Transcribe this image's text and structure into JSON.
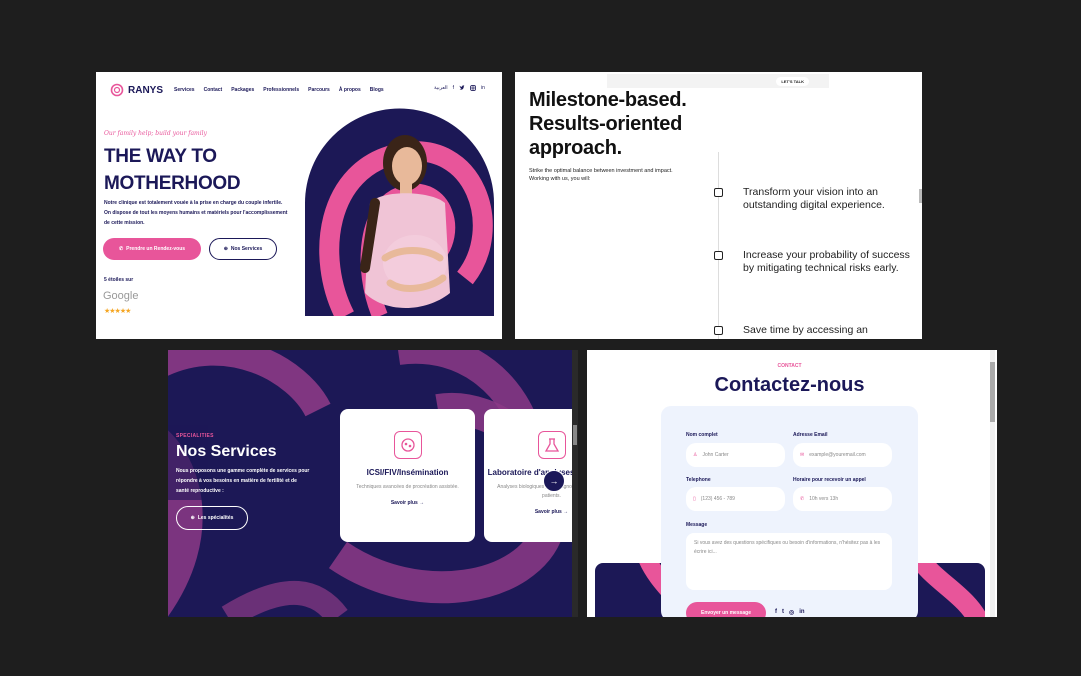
{
  "colors": {
    "navy": "#1b1858",
    "pink": "#e8559a",
    "canvas": "#1e1e1e"
  },
  "panel1": {
    "logo": "RANYS",
    "nav": [
      "Services",
      "Contact",
      "Packages",
      "Professionnels",
      "Parcours",
      "À propos",
      "Blogs"
    ],
    "lang": "العربية",
    "social_icons": [
      "facebook-icon",
      "twitter-icon",
      "instagram-icon",
      "linkedin-icon"
    ],
    "tagline": "Our family help; build your family",
    "title_line1": "THE WAY TO",
    "title_line2": "MOTHERHOOD",
    "description": "Notre clinique est totalement vouée à la prise en charge du couple infertile. On dispose de tout les moyens humains et matériels pour l'accomplissement de cette mission.",
    "btn_primary": "Prendre un Rendez-vous",
    "btn_secondary": "Nos Services",
    "stars_label": "5 étoiles sur",
    "google": "Google",
    "stars": "★★★★★"
  },
  "panel2": {
    "topbar_items": [
      "",
      "",
      "",
      "",
      ""
    ],
    "talk": "LET'S TALK",
    "title_line1": "Milestone-based.",
    "title_line2": "Results-oriented",
    "title_line3": "approach.",
    "subtitle": "Strike the optimal balance between investment and impact. Working with us, you will:",
    "items": [
      "Transform your vision into an outstanding digital experience.",
      "Increase your probability of success by mitigating technical risks early.",
      "Save time by accessing an"
    ]
  },
  "panel3": {
    "eyebrow": "SPECIALITIES",
    "title": "Nos Services",
    "description": "Nous proposons une gamme complète de services pour répondre à vos besoins en matière de fertilité et de santé reproductive :",
    "button": "Les spécialités",
    "cards": [
      {
        "title": "ICSI/FIV/Insémination",
        "desc": "Techniques avancées de procréation assistée.",
        "link": "Savoir plus"
      },
      {
        "title": "Laboratoire d'analyses médicales",
        "desc": "Analyses biologiques pour diagnostic et suivi des patients.",
        "link": "Savoir plus"
      }
    ]
  },
  "panel4": {
    "eyebrow": "CONTACT",
    "title": "Contactez-nous",
    "labels": {
      "name": "Nom complet",
      "email": "Adresse Email",
      "phone": "Telephone",
      "time": "Horaire pour recevoir un appel",
      "message": "Message"
    },
    "placeholders": {
      "name": "John Carter",
      "email": "example@youremail.com",
      "phone": "(123) 456 - 789",
      "time": "10h vers 13h"
    },
    "message_placeholder": "Si vous avez des questions spécifiques ou besoin d'informations, n'hésitez pas à les écrire ici...",
    "send": "Envoyer un message"
  }
}
